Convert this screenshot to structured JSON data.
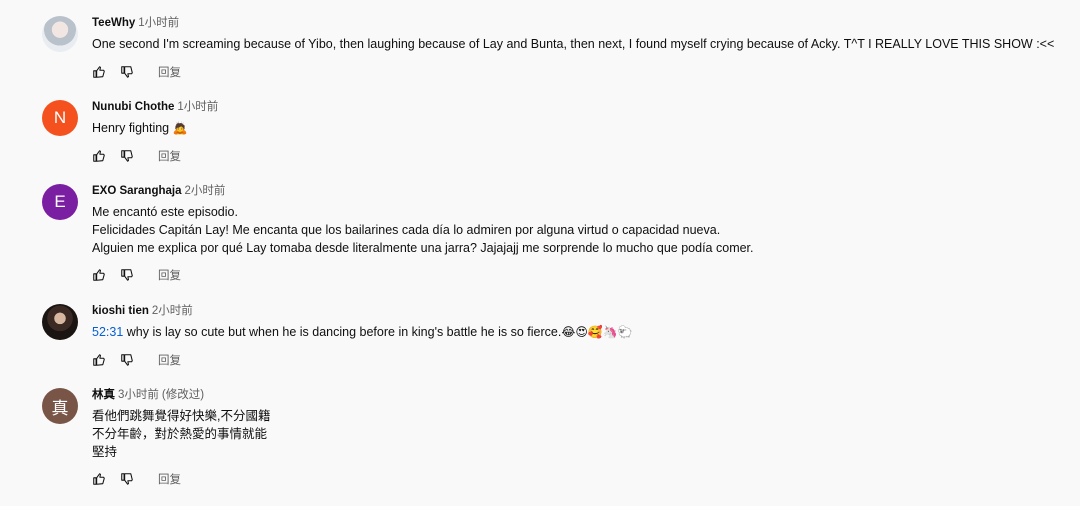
{
  "comments": [
    {
      "author": "TeeWhy",
      "time": "1小时前",
      "avatar": {
        "type": "photo",
        "letter": "",
        "color": "#b9c2cb"
      },
      "lines": [
        "One second I'm screaming because of Yibo, then laughing because of Lay and Bunta, then next, I found myself crying because of Acky. T^T I REALLY LOVE THIS SHOW :<<"
      ],
      "reply_label": "回复"
    },
    {
      "author": "Nunubi Chothe",
      "time": "1小时前",
      "avatar": {
        "type": "letter",
        "letter": "N",
        "color": "#f4511e"
      },
      "lines": [
        "Henry fighting"
      ],
      "emoji": "🙇",
      "reply_label": "回复"
    },
    {
      "author": "EXO Saranghaja",
      "time": "2小时前",
      "avatar": {
        "type": "letter",
        "letter": "E",
        "color": "#7b1fa2"
      },
      "lines": [
        "Me encantó este episodio.",
        "Felicidades Capitán Lay! Me encanta que los bailarines cada día lo admiren por alguna virtud o capacidad nueva.",
        "Alguien me explica por qué Lay tomaba desde literalmente una jarra? Jajajajj me sorprende lo mucho que podía comer."
      ],
      "reply_label": "回复"
    },
    {
      "author": "kioshi tien",
      "time": "2小时前",
      "avatar": {
        "type": "photo",
        "letter": "",
        "color": "#3b2a24"
      },
      "timestamp_link": "52:31",
      "lines": [
        " why is lay so cute but when he is dancing before in king's battle he is so fierce."
      ],
      "emoji": "😂😍🥰🦄🐑",
      "reply_label": "回复"
    },
    {
      "author": "林真",
      "time": "3小时前",
      "edited": "(修改过)",
      "avatar": {
        "type": "letter",
        "letter": "真",
        "color": "#795548"
      },
      "lines": [
        "看他們跳舞覺得好快樂,不分國籍",
        "不分年齡，對於熱愛的事情就能",
        "堅持"
      ],
      "reply_label": "回复"
    }
  ],
  "icons": {
    "like": "thumb-up-icon",
    "dislike": "thumb-down-icon"
  }
}
